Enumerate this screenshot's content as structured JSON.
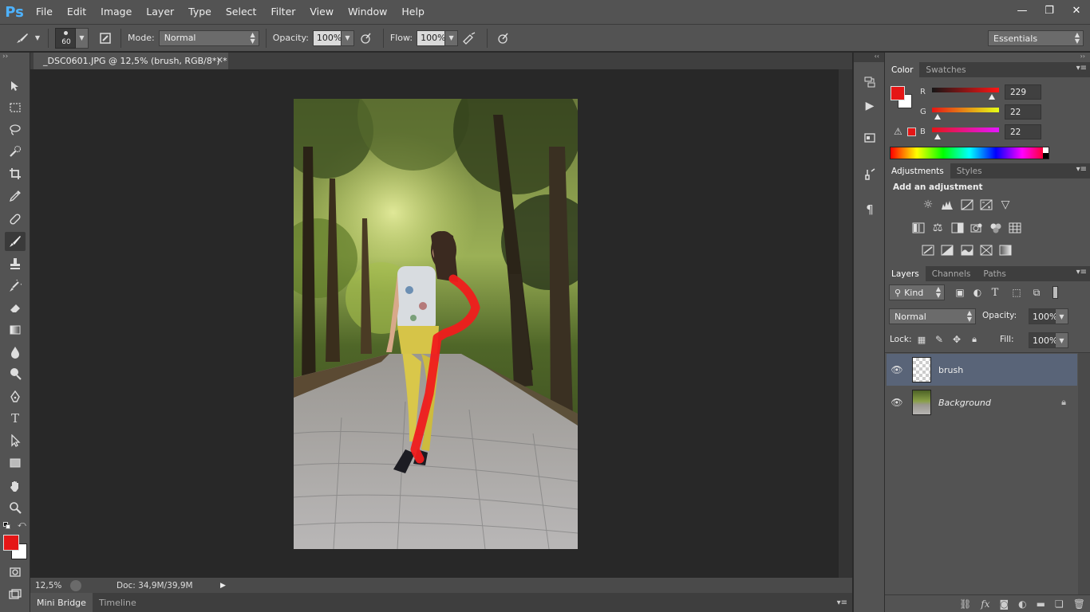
{
  "app": {
    "logo": "Ps",
    "menu": [
      "File",
      "Edit",
      "Image",
      "Layer",
      "Type",
      "Select",
      "Filter",
      "View",
      "Window",
      "Help"
    ],
    "window_controls": {
      "minimize": "—",
      "restore": "❐",
      "close": "✕"
    }
  },
  "options_bar": {
    "brush_size": "60",
    "mode_label": "Mode:",
    "mode_value": "Normal",
    "opacity_label": "Opacity:",
    "opacity_value": "100%",
    "flow_label": "Flow:",
    "flow_value": "100%",
    "workspace": "Essentials"
  },
  "document": {
    "tab_title": "_DSC0601.JPG @ 12,5% (brush, RGB/8*) *",
    "zoom": "12,5%",
    "doc_info": "Doc: 34,9M/39,9M"
  },
  "bottom_tabs": [
    "Mini Bridge",
    "Timeline"
  ],
  "colors": {
    "foreground": "#e51616",
    "background": "#ffffff",
    "accent_selection": "#596478"
  },
  "color_panel": {
    "tabs": [
      "Color",
      "Swatches"
    ],
    "r_label": "R",
    "r_value": "229",
    "g_label": "G",
    "g_value": "22",
    "b_label": "B",
    "b_value": "22"
  },
  "adjustments_panel": {
    "tabs": [
      "Adjustments",
      "Styles"
    ],
    "heading": "Add an adjustment"
  },
  "layers_panel": {
    "tabs": [
      "Layers",
      "Channels",
      "Paths"
    ],
    "filter_kind": "Kind",
    "blend_mode": "Normal",
    "opacity_label": "Opacity:",
    "opacity_value": "100%",
    "lock_label": "Lock:",
    "fill_label": "Fill:",
    "fill_value": "100%",
    "layers": [
      {
        "name": "brush",
        "selected": true
      },
      {
        "name": "Background",
        "selected": false,
        "locked": true
      }
    ]
  }
}
